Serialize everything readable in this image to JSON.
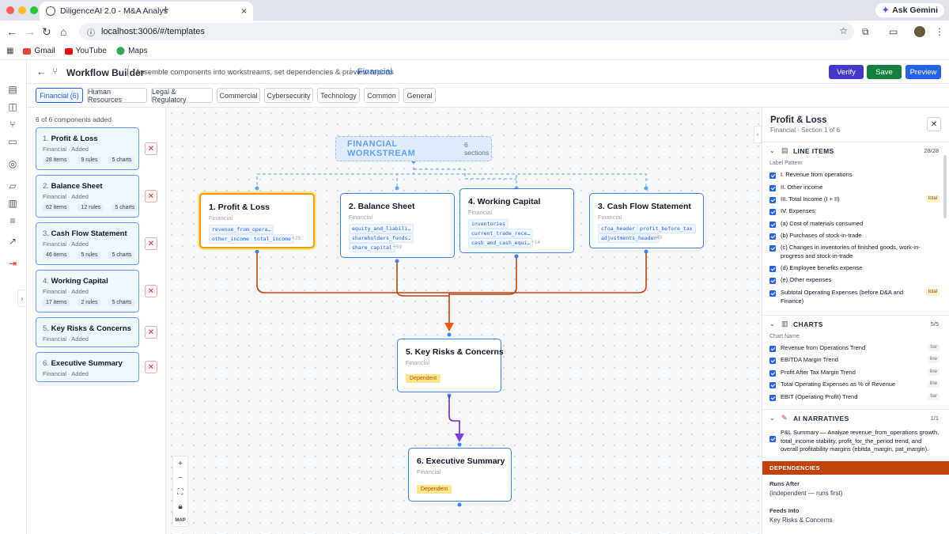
{
  "browser": {
    "tab_title": "DiligenceAI 2.0 - M&A Analys",
    "url": "localhost:3006/#/templates",
    "ask_label": "Ask Gemini",
    "bookmarks": [
      "Gmail",
      "YouTube",
      "Maps"
    ]
  },
  "header": {
    "title": "Workflow Builder",
    "subtitle": "Assemble components into workstreams, set dependencies & preview reports",
    "slash": "/",
    "crumb": "Financial",
    "verify": "Verify",
    "save": "Save",
    "preview": "Preview"
  },
  "categories": [
    "Financial  (6)",
    "Human Resources",
    "Legal & Regulatory",
    "Commercial",
    "Cybersecurity",
    "Technology",
    "Common",
    "General"
  ],
  "list": {
    "count_text": "6 of 6 components added",
    "items": [
      {
        "num": "1.",
        "name": "Profit & Loss",
        "meta": "Financial · Added",
        "items": "28 items",
        "rules": "9 rules",
        "charts": "5 charts"
      },
      {
        "num": "2.",
        "name": "Balance Sheet",
        "meta": "Financial · Added",
        "items": "62 items",
        "rules": "12 rules",
        "charts": "5 charts"
      },
      {
        "num": "3.",
        "name": "Cash Flow Statement",
        "meta": "Financial · Added",
        "items": "46 items",
        "rules": "5 rules",
        "charts": "5 charts"
      },
      {
        "num": "4.",
        "name": "Working Capital",
        "meta": "Financial · Added",
        "items": "17 items",
        "rules": "2 rules",
        "charts": "5 charts"
      },
      {
        "num": "5.",
        "name": "Key Risks & Concerns",
        "meta": "Financial · Added"
      },
      {
        "num": "6.",
        "name": "Executive Summary",
        "meta": "Financial · Added"
      }
    ]
  },
  "canvas": {
    "workstream_title": "FINANCIAL WORKSTREAM",
    "workstream_sections": "6 sections",
    "nodes": {
      "pl": {
        "title": "1. Profit & Loss",
        "sub": "Financial",
        "chips": [
          "revenue_from_opera…",
          "other_income",
          "total_income"
        ],
        "more": "+25"
      },
      "bs": {
        "title": "2. Balance Sheet",
        "sub": "Financial",
        "chips": [
          "equity_and_liabili…",
          "shareholders_funds…",
          "share_capital"
        ],
        "more": "+59"
      },
      "wc": {
        "title": "4. Working Capital",
        "sub": "Financial",
        "chips": [
          "inventories",
          "current_trade_rece…",
          "cash_and_cash_equi…"
        ],
        "more": "+14"
      },
      "cf": {
        "title": "3. Cash Flow Statement",
        "sub": "Financial",
        "chips": [
          "cfoa_header",
          "profit_before_tax",
          "adjustments_header"
        ],
        "more": "+43"
      },
      "kr": {
        "title": "5. Key Risks & Concerns",
        "sub": "Financial",
        "tag": "Dependent"
      },
      "es": {
        "title": "6. Executive Summary",
        "sub": "Financial",
        "tag": "Dependent"
      }
    },
    "zoom": {
      "map": "MAP"
    }
  },
  "panel": {
    "title": "Profit & Loss",
    "subtitle": "Financial · Section 1 of 6",
    "line_items": {
      "title": "LINE ITEMS",
      "count": "28/28",
      "label": "Label Pattern",
      "rows": [
        {
          "text": "I. Revenue from operations"
        },
        {
          "text": "II. Other income"
        },
        {
          "text": "III. Total Income (I + II)",
          "tag": "total"
        },
        {
          "text": "IV. Expenses:"
        },
        {
          "text": "(a) Cost of materials consumed"
        },
        {
          "text": "(b) Purchases of stock-in-trade"
        },
        {
          "text": "(c) Changes in inventories of finished goods, work-in-progress and stock-in-trade"
        },
        {
          "text": "(d) Employee benefits expense"
        },
        {
          "text": "(e) Other expenses"
        },
        {
          "text": "Subtotal Operating Expenses (before D&A and Finance)",
          "tag": "total"
        }
      ]
    },
    "charts": {
      "title": "CHARTS",
      "count": "5/5",
      "label": "Chart Name",
      "rows": [
        {
          "text": "Revenue from Operations Trend",
          "tag": "bar"
        },
        {
          "text": "EBITDA Margin Trend",
          "tag": "line"
        },
        {
          "text": "Profit After Tax Margin Trend",
          "tag": "line"
        },
        {
          "text": "Total Operating Expenses as % of Revenue",
          "tag": "line"
        },
        {
          "text": "EBIT (Operating Profit) Trend",
          "tag": "bar"
        }
      ]
    },
    "narratives": {
      "title": "AI NARRATIVES",
      "count": "1/1",
      "text": "P&L Summary — Analyze revenue_from_operations growth, total_income stability, profit_for_the_period trend, and overall profitability margins (ebitda_margin, pat_margin)."
    },
    "dependencies": {
      "title": "DEPENDENCIES",
      "runs_after_label": "Runs After",
      "runs_after_value": "(independent — runs first)",
      "feeds_into_label": "Feeds Into",
      "feeds_into_value": "Key Risks & Concerns"
    }
  },
  "colors": {
    "primary": "#2563eb",
    "save": "#15803d",
    "accent_orange": "#c2410c",
    "selected": "#f59e0b",
    "purple": "#6d28d9"
  }
}
